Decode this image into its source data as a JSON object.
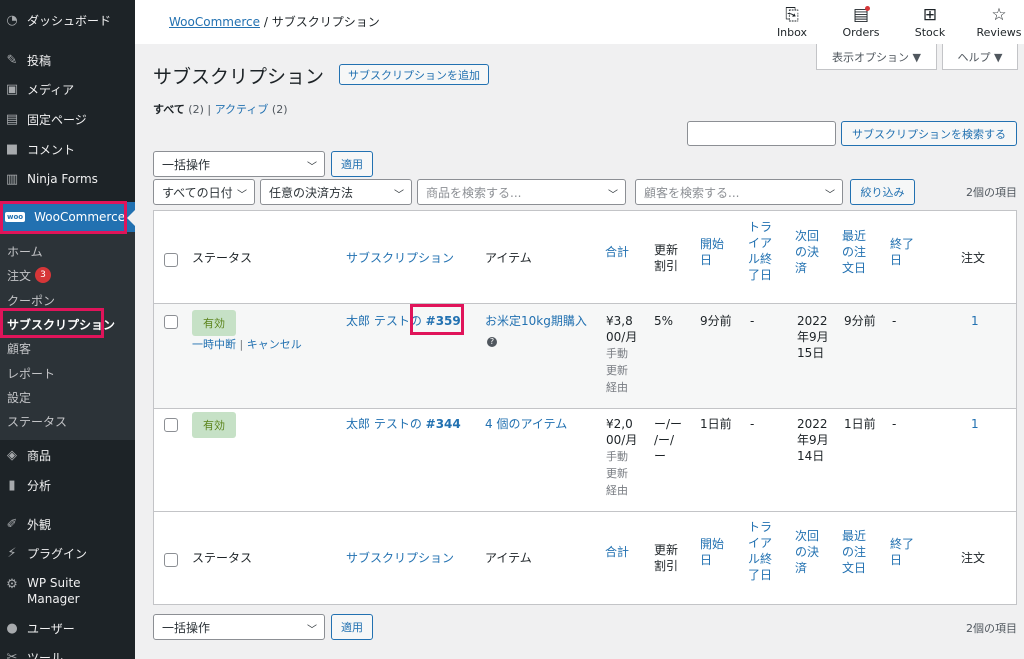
{
  "sidebar": {
    "items": [
      {
        "label": "ダッシュボード",
        "icon": "dashboard-icon"
      },
      {
        "label": "投稿",
        "icon": "pin-icon"
      },
      {
        "label": "メディア",
        "icon": "media-icon"
      },
      {
        "label": "固定ページ",
        "icon": "page-icon"
      },
      {
        "label": "コメント",
        "icon": "comment-icon"
      },
      {
        "label": "Ninja Forms",
        "icon": "form-icon"
      },
      {
        "label": "WooCommerce",
        "icon": "woo-icon",
        "logo": "woo"
      },
      {
        "label": "商品",
        "icon": "box-icon"
      },
      {
        "label": "分析",
        "icon": "chart-icon"
      },
      {
        "label": "外観",
        "icon": "brush-icon"
      },
      {
        "label": "プラグイン",
        "icon": "plugin-icon"
      },
      {
        "label": "WP Suite",
        "label2": "Manager",
        "icon": "gear-icon"
      },
      {
        "label": "ユーザー",
        "icon": "user-icon"
      },
      {
        "label": "ツール",
        "icon": "wrench-icon"
      }
    ],
    "submenu": [
      {
        "label": "ホーム"
      },
      {
        "label": "注文",
        "badge": "3"
      },
      {
        "label": "クーポン"
      },
      {
        "label": "サブスクリプション"
      },
      {
        "label": "顧客"
      },
      {
        "label": "レポート"
      },
      {
        "label": "設定"
      },
      {
        "label": "ステータス"
      }
    ]
  },
  "topbar": {
    "breadcrumb_link": "WooCommerce",
    "breadcrumb_sep": "/",
    "breadcrumb_current": "サブスクリプション",
    "icons": [
      {
        "label": "Inbox",
        "icon": "inbox-icon"
      },
      {
        "label": "Orders",
        "icon": "orders-icon"
      },
      {
        "label": "Stock",
        "icon": "stock-icon"
      },
      {
        "label": "Reviews",
        "icon": "star-icon"
      }
    ],
    "screen_options": "表示オプション ▼",
    "help": "ヘルプ ▼"
  },
  "page": {
    "title": "サブスクリプション",
    "add_button": "サブスクリプションを追加",
    "filter_all": "すべて",
    "filter_all_count": "(2)",
    "filter_sep": "|",
    "filter_active": "アクティブ",
    "filter_active_count": "(2)",
    "search_button": "サブスクリプションを検索する",
    "search_value": ""
  },
  "toolbar": {
    "bulk_action": "一括操作",
    "apply": "適用",
    "date_filter": "すべての日付",
    "payment_filter": "任意の決済方法",
    "product_search": "商品を検索する...",
    "customer_search": "顧客を検索する...",
    "filter_button": "絞り込み",
    "item_count": "2個の項目"
  },
  "table": {
    "headers": {
      "status": "ステータス",
      "subscription": "サブスクリプション",
      "item": "アイテム",
      "total": "合計",
      "renewal_discount": [
        "更新",
        "割引"
      ],
      "start": [
        "開始",
        "日"
      ],
      "trial_end": [
        "トラ",
        "イア",
        "ル終",
        "了日"
      ],
      "next_payment": [
        "次回",
        "の決",
        "済"
      ],
      "last_order": [
        "最近",
        "の注",
        "文日"
      ],
      "end": [
        "終了",
        "日"
      ],
      "orders": "注文"
    },
    "rows": [
      {
        "status": "有効",
        "actions_suspend": "一時中断",
        "actions_sep": "|",
        "actions_cancel": "キャンセル",
        "customer_prefix": "太郎 テストの",
        "sub_id": "#359",
        "item": "お米定10kg期購入",
        "total_lines": [
          "¥3,8",
          "00/月"
        ],
        "via_lines": [
          "手動",
          "更新",
          "経由"
        ],
        "renewal_discount": "5%",
        "start": "9分前",
        "trial_end": "-",
        "next_payment_lines": [
          "2022",
          "年9月",
          "15日"
        ],
        "last_order": "9分前",
        "end": "-",
        "orders": "1"
      },
      {
        "status": "有効",
        "customer_prefix": "太郎 テストの",
        "sub_id": "#344",
        "item": "4 個のアイテム",
        "total_lines": [
          "¥2,0",
          "00/月"
        ],
        "via_lines": [
          "手動",
          "更新",
          "経由"
        ],
        "renewal_discount_lines": [
          "ー/ー",
          "/ー/",
          "ー"
        ],
        "start": "1日前",
        "trial_end": "-",
        "next_payment_lines": [
          "2022",
          "年9月",
          "14日"
        ],
        "last_order": "1日前",
        "end": "-",
        "orders": "1"
      }
    ]
  },
  "colors": {
    "accent": "#2271b1",
    "sidebar": "#1d2327",
    "highlight": "#e0145a",
    "status_bg": "#c6e1c6",
    "status_fg": "#5b841b"
  }
}
